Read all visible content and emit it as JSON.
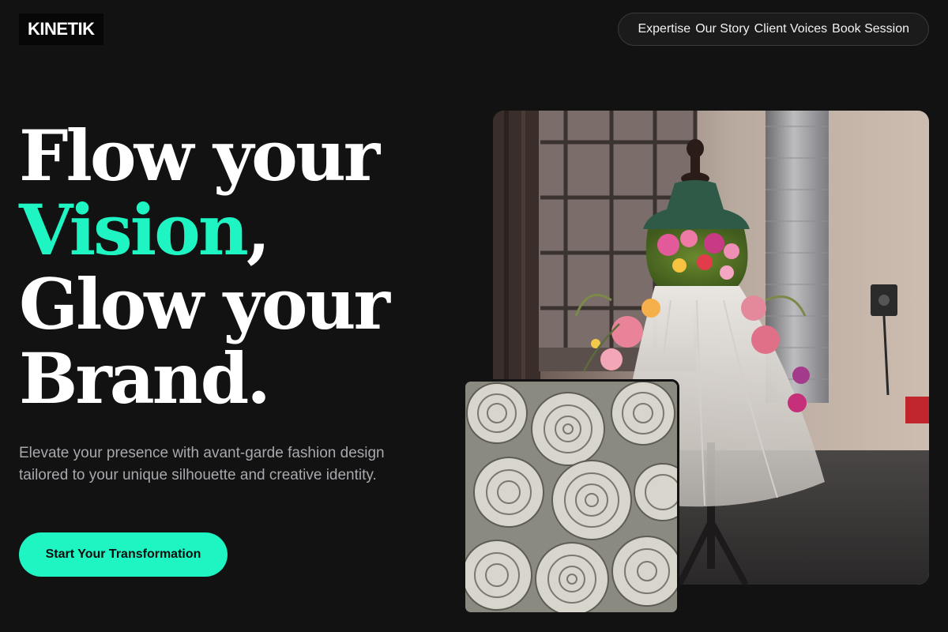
{
  "brand": {
    "logo_text": "KINETIK"
  },
  "nav": {
    "links": [
      {
        "label": "Expertise"
      },
      {
        "label": "Our Story"
      },
      {
        "label": "Client Voices"
      },
      {
        "label": "Book Session"
      }
    ]
  },
  "hero": {
    "line1": "Flow your",
    "line2_accent": "Vision",
    "line2_tail": ",",
    "line3": "Glow your",
    "line4": "Brand.",
    "description": "Elevate your presence with avant-garde fashion design tailored to your unique silhouette and creative identity.",
    "cta_label": "Start Your Transformation"
  },
  "images": {
    "main": "floral-dress-mannequin-photo",
    "inset": "rolled-fabric-roses-photo"
  },
  "colors": {
    "background": "#121213",
    "accent": "#1ef5c3",
    "text": "#ffffff",
    "muted_text": "#a8a8ad"
  }
}
